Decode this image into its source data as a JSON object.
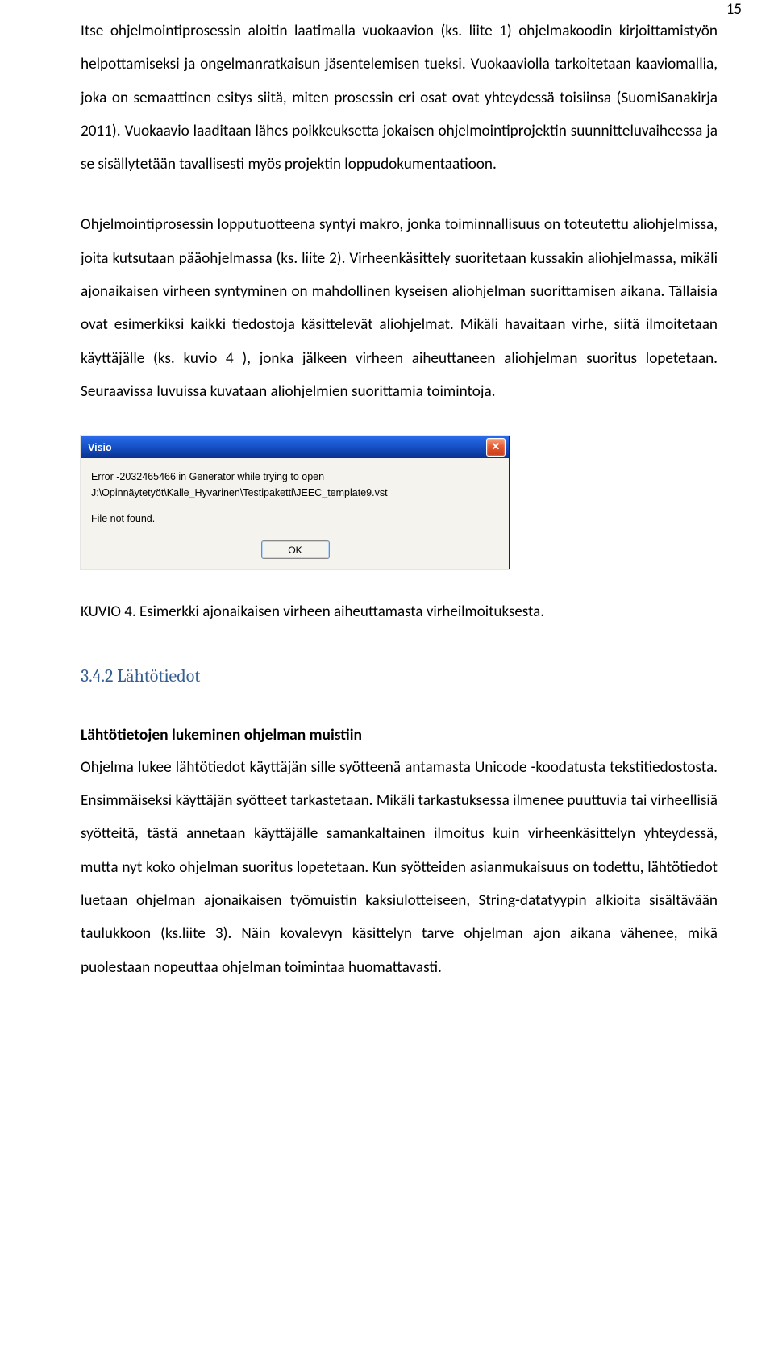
{
  "page_number": "15",
  "para1": "Itse ohjelmointiprosessin aloitin laatimalla vuokaavion (ks. liite 1) ohjelmakoodin kirjoittamistyön helpottamiseksi ja ongelmanratkaisun jäsentelemisen tueksi. Vuokaaviolla tarkoitetaan kaaviomallia, joka on semaattinen esitys siitä, miten prosessin eri osat ovat yhteydessä toisiinsa (SuomiSanakirja 2011). Vuokaavio laaditaan lähes poikkeuksetta jokaisen ohjelmointiprojektin suunnitteluvaiheessa ja se sisällytetään tavallisesti myös projektin loppudokumentaatioon.",
  "para2": "Ohjelmointiprosessin lopputuotteena syntyi makro, jonka toiminnallisuus on toteutettu aliohjelmissa, joita kutsutaan pääohjelmassa (ks. liite 2). Virheenkäsittely suoritetaan kussakin aliohjelmassa, mikäli ajonaikaisen virheen syntyminen on mahdollinen kyseisen aliohjelman suorittamisen aikana. Tällaisia ovat esimerkiksi kaikki tiedostoja käsittelevät aliohjelmat. Mikäli havaitaan virhe, siitä ilmoitetaan käyttäjälle (ks. kuvio 4 ), jonka jälkeen virheen aiheuttaneen aliohjelman suoritus lopetetaan. Seuraavissa luvuissa kuvataan aliohjelmien suorittamia toimintoja.",
  "dialog": {
    "title": "Visio",
    "line1": "Error -2032465466 in Generator while trying to open",
    "line2": "J:\\Opinnäytetyöt\\Kalle_Hyvarinen\\Testipaketti\\JEEC_template9.vst",
    "line3": "File not found.",
    "ok": "OK"
  },
  "figure_caption": "KUVIO 4. Esimerkki ajonaikaisen virheen aiheuttamasta virheilmoituksesta.",
  "section_heading": "3.4.2 Lähtötiedot",
  "subheading": "Lähtötietojen lukeminen ohjelman muistiin",
  "para3": "Ohjelma lukee lähtötiedot käyttäjän sille syötteenä antamasta Unicode -koodatusta tekstitiedostosta. Ensimmäiseksi käyttäjän syötteet tarkastetaan. Mikäli tarkastuksessa ilmenee puuttuvia tai virheellisiä syötteitä, tästä annetaan käyttäjälle samankaltainen ilmoitus kuin virheenkäsittelyn yhteydessä, mutta nyt koko ohjelman suoritus lopetetaan. Kun syötteiden asianmukaisuus on todettu, lähtötiedot luetaan ohjelman ajonaikaisen työmuistin kaksiulotteiseen, String-datatyypin alkioita sisältävään taulukkoon (ks.liite 3). Näin kovalevyn käsittelyn tarve ohjelman ajon aikana vähenee, mikä puolestaan nopeuttaa ohjelman toimintaa huomattavasti."
}
